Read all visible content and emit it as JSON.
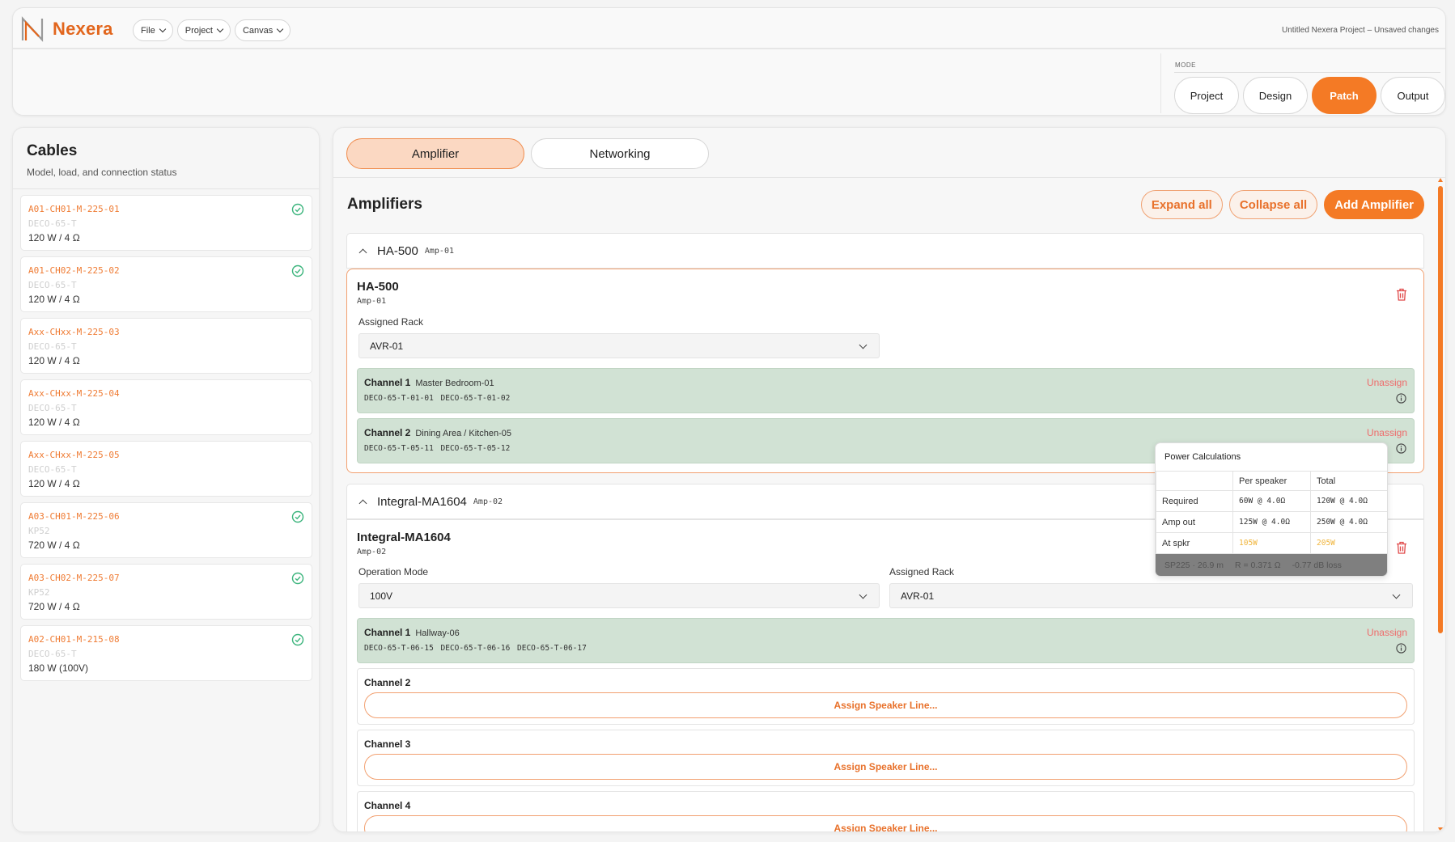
{
  "app": {
    "name": "Nexera",
    "menus": [
      "File",
      "Project",
      "Canvas"
    ],
    "doc_status": "Untitled Nexera Project – Unsaved changes"
  },
  "mode": {
    "label": "MODE",
    "options": [
      "Project",
      "Design",
      "Patch",
      "Output"
    ],
    "active": "Patch"
  },
  "sidebar": {
    "title": "Cables",
    "subtitle": "Model, load, and connection status",
    "cables": [
      {
        "id": "A01-CH01-M-225-01",
        "model": "DECO-65-T",
        "load": "120 W / 4 Ω",
        "connected": true
      },
      {
        "id": "A01-CH02-M-225-02",
        "model": "DECO-65-T",
        "load": "120 W / 4 Ω",
        "connected": true
      },
      {
        "id": "Axx-CHxx-M-225-03",
        "model": "DECO-65-T",
        "load": "120 W / 4 Ω",
        "connected": false
      },
      {
        "id": "Axx-CHxx-M-225-04",
        "model": "DECO-65-T",
        "load": "120 W / 4 Ω",
        "connected": false
      },
      {
        "id": "Axx-CHxx-M-225-05",
        "model": "DECO-65-T",
        "load": "120 W / 4 Ω",
        "connected": false
      },
      {
        "id": "A03-CH01-M-225-06",
        "model": "KP52",
        "load": "720 W / 4 Ω",
        "connected": true
      },
      {
        "id": "A03-CH02-M-225-07",
        "model": "KP52",
        "load": "720 W / 4 Ω",
        "connected": true
      },
      {
        "id": "A02-CH01-M-215-08",
        "model": "DECO-65-T",
        "load": "180 W (100V)",
        "connected": true
      }
    ]
  },
  "main": {
    "tabs": [
      "Amplifier",
      "Networking"
    ],
    "active_tab": "Amplifier",
    "title": "Amplifiers",
    "actions": {
      "expand": "Expand all",
      "collapse": "Collapse all",
      "add": "Add Amplifier"
    },
    "amps": [
      {
        "model": "HA-500",
        "tag": "Amp-01",
        "rack_label": "Assigned Rack",
        "rack": "AVR-01",
        "channels": [
          {
            "name": "Channel 1",
            "room": "Master Bedroom-01",
            "speakers": "DECO-65-T-01-01  DECO-65-T-01-02",
            "action": "Unassign"
          },
          {
            "name": "Channel 2",
            "room": "Dining Area / Kitchen-05",
            "speakers": "DECO-65-T-05-11  DECO-65-T-05-12",
            "action": "Unassign"
          }
        ]
      },
      {
        "model": "Integral-MA1604",
        "tag": "Amp-02",
        "mode_label": "Operation Mode",
        "mode_value": "100V",
        "rack_label": "Assigned Rack",
        "rack": "AVR-01",
        "channels": [
          {
            "name": "Channel 1",
            "room": "Hallway-06",
            "speakers": "DECO-65-T-06-15  DECO-65-T-06-16  DECO-65-T-06-17",
            "action": "Unassign"
          },
          {
            "name": "Channel 2",
            "assign": "Assign Speaker Line..."
          },
          {
            "name": "Channel 3",
            "assign": "Assign Speaker Line..."
          },
          {
            "name": "Channel 4",
            "assign": "Assign Speaker Line..."
          }
        ]
      }
    ]
  },
  "power_tooltip": {
    "title": "Power Calculations",
    "columns": [
      "",
      "Per speaker",
      "Total"
    ],
    "rows": [
      {
        "label": "Required",
        "per": "60W @ 4.0Ω",
        "total": "120W @ 4.0Ω"
      },
      {
        "label": "Amp out",
        "per": "125W @ 4.0Ω",
        "total": "250W @ 4.0Ω"
      },
      {
        "label": "At spkr",
        "per": "105W",
        "total": "205W"
      }
    ],
    "footer": [
      "SP225 · 26.9 m",
      "R = 0.371 Ω",
      "-0.77 dB loss"
    ]
  },
  "colors": {
    "accent": "#f47a25",
    "channel_assigned": "#d1e2d4",
    "danger": "#ef6b6b",
    "ok": "#3bb47c"
  }
}
